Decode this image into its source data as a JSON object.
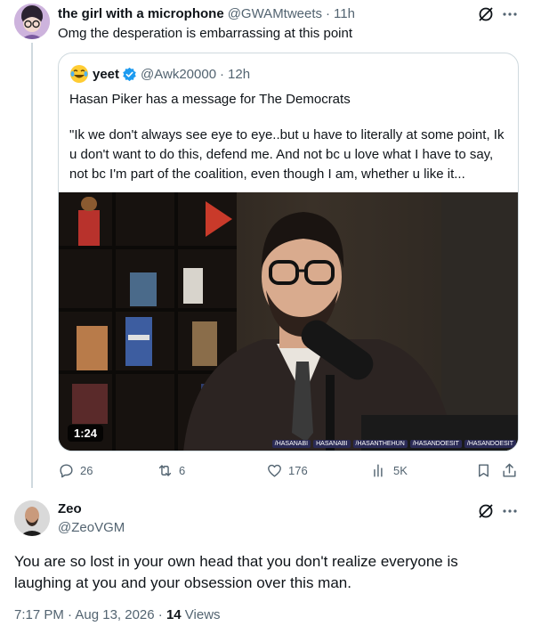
{
  "tweet": {
    "author_name": "the girl with a microphone",
    "author_handle": "@GWAMtweets",
    "separator": "·",
    "time": "11h",
    "text": "Omg the desperation is embarrassing at this point",
    "quote": {
      "emoji": "😂",
      "author_name": "yeet",
      "author_handle": "@Awk20000",
      "separator": "·",
      "time": "12h",
      "paragraph1": "Hasan Piker has a message for The Democrats",
      "paragraph2": "\"Ik we don't always see eye to eye..but u have to literally at some point, Ik u don't want to do this, defend me. And not bc u love what I have to say, not bc I'm part of the coalition, even though I am, whether u like it...",
      "video_duration": "1:24",
      "video_socials": [
        "/HASANABI",
        "HASANABI",
        "/HASANTHEHUN",
        "/HASANDOESIT",
        "/HASANDOESIT"
      ]
    },
    "actions": {
      "replies": "26",
      "reposts": "6",
      "likes": "176",
      "views": "5K"
    }
  },
  "reply": {
    "author_name": "Zeo",
    "author_handle": "@ZeoVGM",
    "text": "You are so lost in your own head that you don't realize everyone is laughing at you and your obsession over this man.",
    "timestamp": "7:17 PM · Aug 13, 2026 · ",
    "views_count": "14",
    "views_label": " Views"
  },
  "colors": {
    "text_primary": "#0f1419",
    "text_secondary": "#536471",
    "border": "#cfd9de",
    "verified_blue": "#1d9bf0"
  },
  "icons": {
    "reply": "reply-icon",
    "repost": "repost-icon",
    "like": "like-icon",
    "views": "views-icon",
    "bookmark": "bookmark-icon",
    "share": "share-icon",
    "grok": "grok-icon",
    "more": "more-icon",
    "verified": "verified-badge-icon"
  }
}
